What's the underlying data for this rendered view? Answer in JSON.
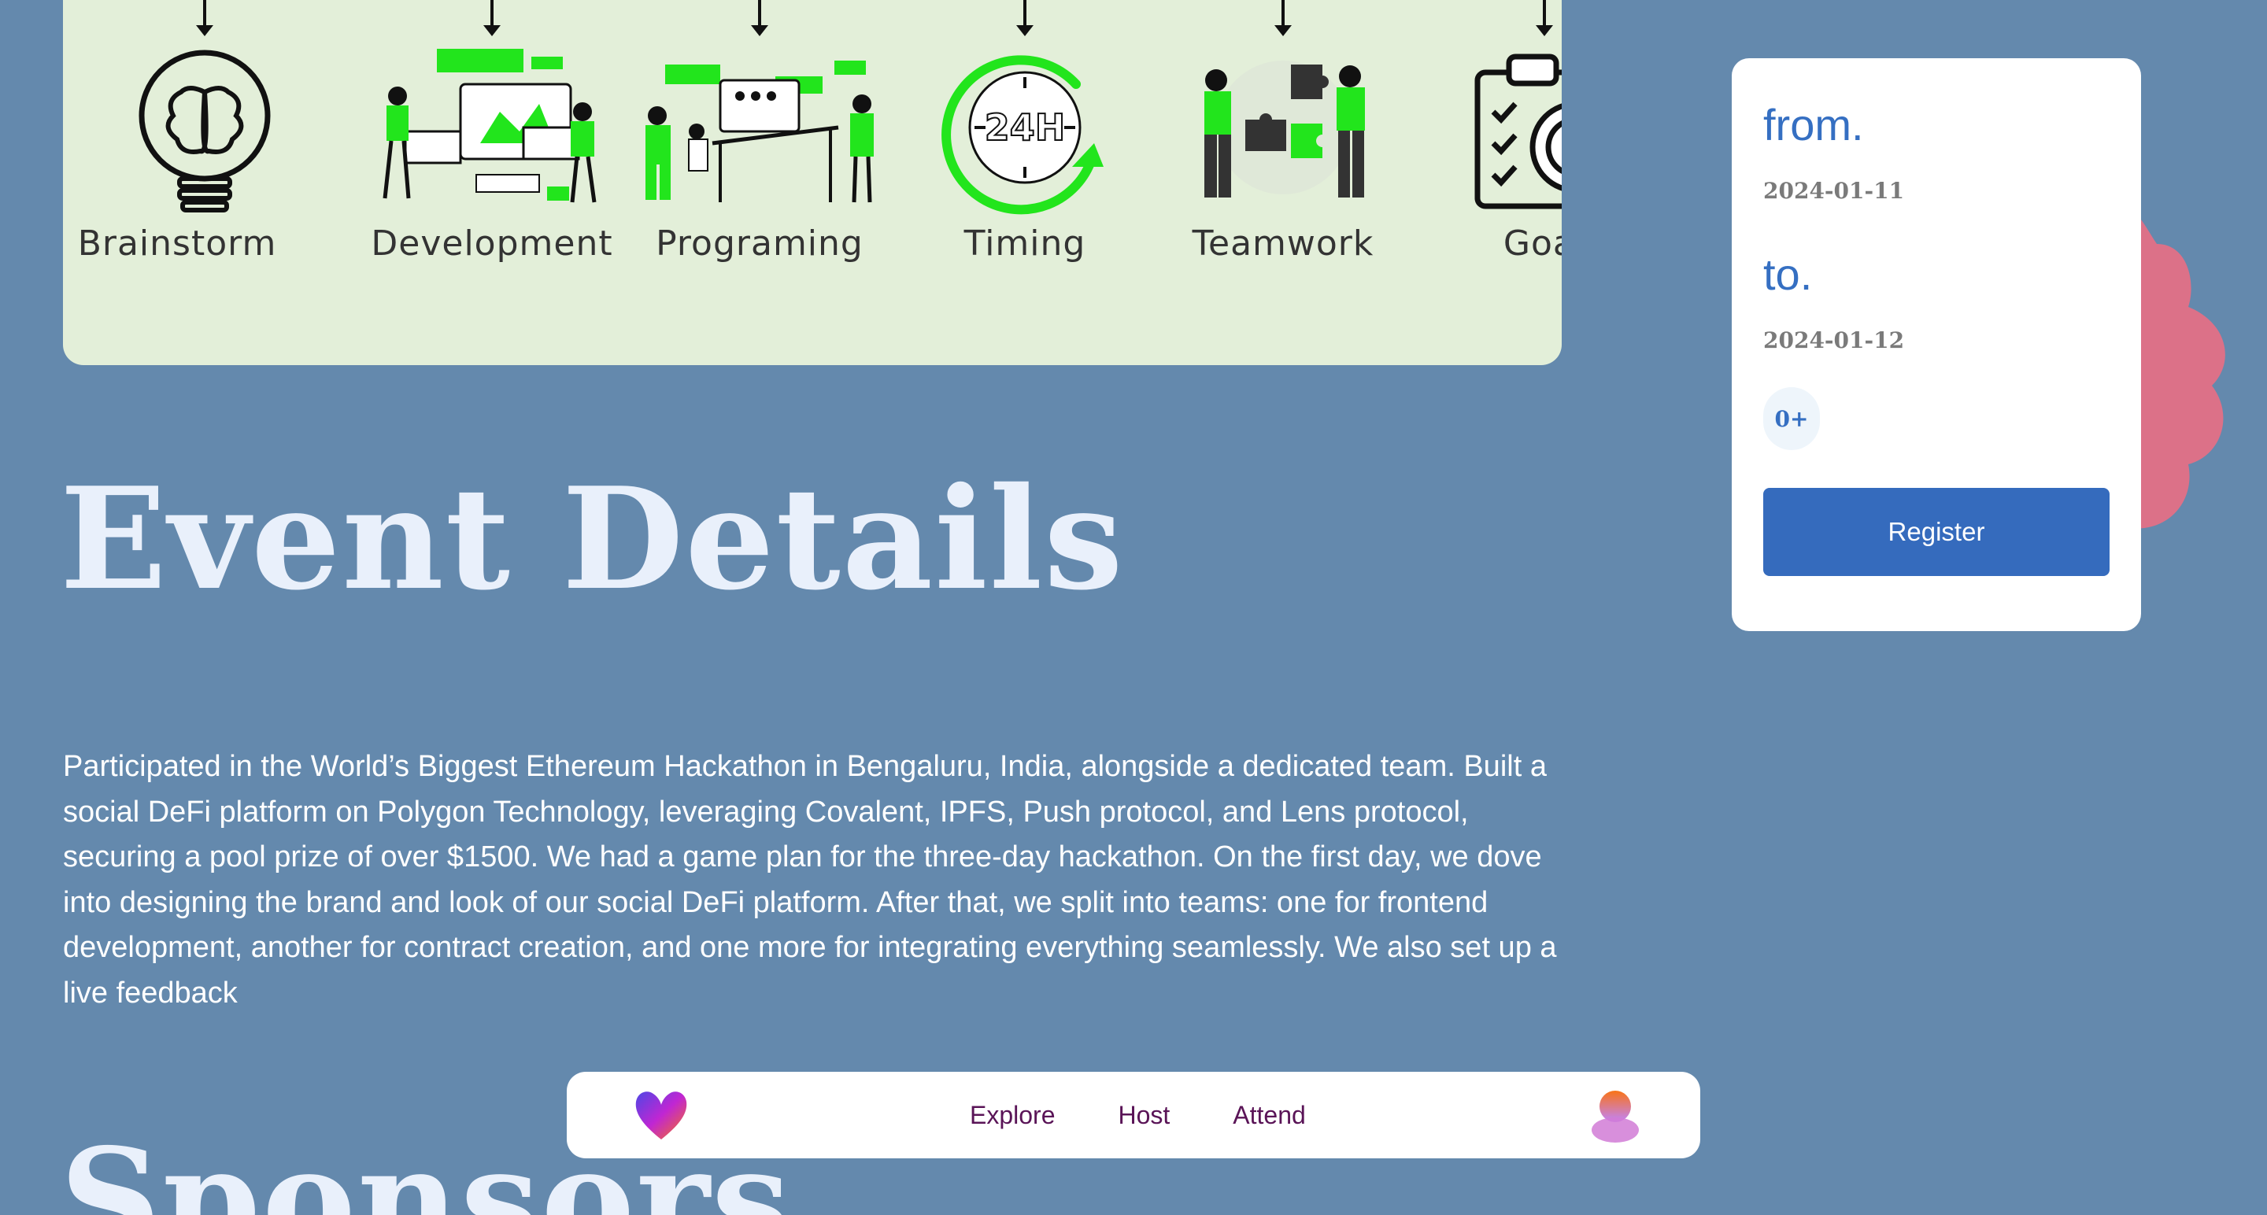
{
  "banner": {
    "stages": [
      {
        "label": "Brainstorm",
        "icon": "lightbulb-brain-icon"
      },
      {
        "label": "Development",
        "icon": "development-team-icon"
      },
      {
        "label": "Programing",
        "icon": "programming-team-icon"
      },
      {
        "label": "Timing",
        "icon": "clock-24h-icon"
      },
      {
        "label": "Teamwork",
        "icon": "puzzle-teamwork-icon"
      },
      {
        "label": "Goal",
        "icon": "clipboard-target-icon"
      }
    ],
    "accent": "#22e51c",
    "background": "#e3efd9"
  },
  "section": {
    "event_title": "Event Details",
    "description": "Participated in the World’s Biggest Ethereum Hackathon in Bengaluru, India, alongside a dedicated team. Built a social DeFi platform on Polygon Technology, leveraging Covalent, IPFS, Push protocol, and Lens protocol, securing a pool prize of over $1500. We had a game plan for the three-day hackathon. On the first day, we dove into designing the brand and look of our social DeFi platform. After that, we split into teams: one for frontend development, another for contract creation, and one more for integrating everything seamlessly. We also set up a live feedback",
    "sponsors_title": "Sponsors"
  },
  "card": {
    "from_label": "from.",
    "from_date": "2024-01-11",
    "to_label": "to.",
    "to_date": "2024-01-12",
    "attendee_count": "0+",
    "register_label": "Register"
  },
  "nav": {
    "links": [
      "Explore",
      "Host",
      "Attend"
    ]
  },
  "colors": {
    "page_bg": "#6489ad",
    "primary": "#356bbd",
    "blob": "#dc7188",
    "nav_link": "#5a1457"
  }
}
